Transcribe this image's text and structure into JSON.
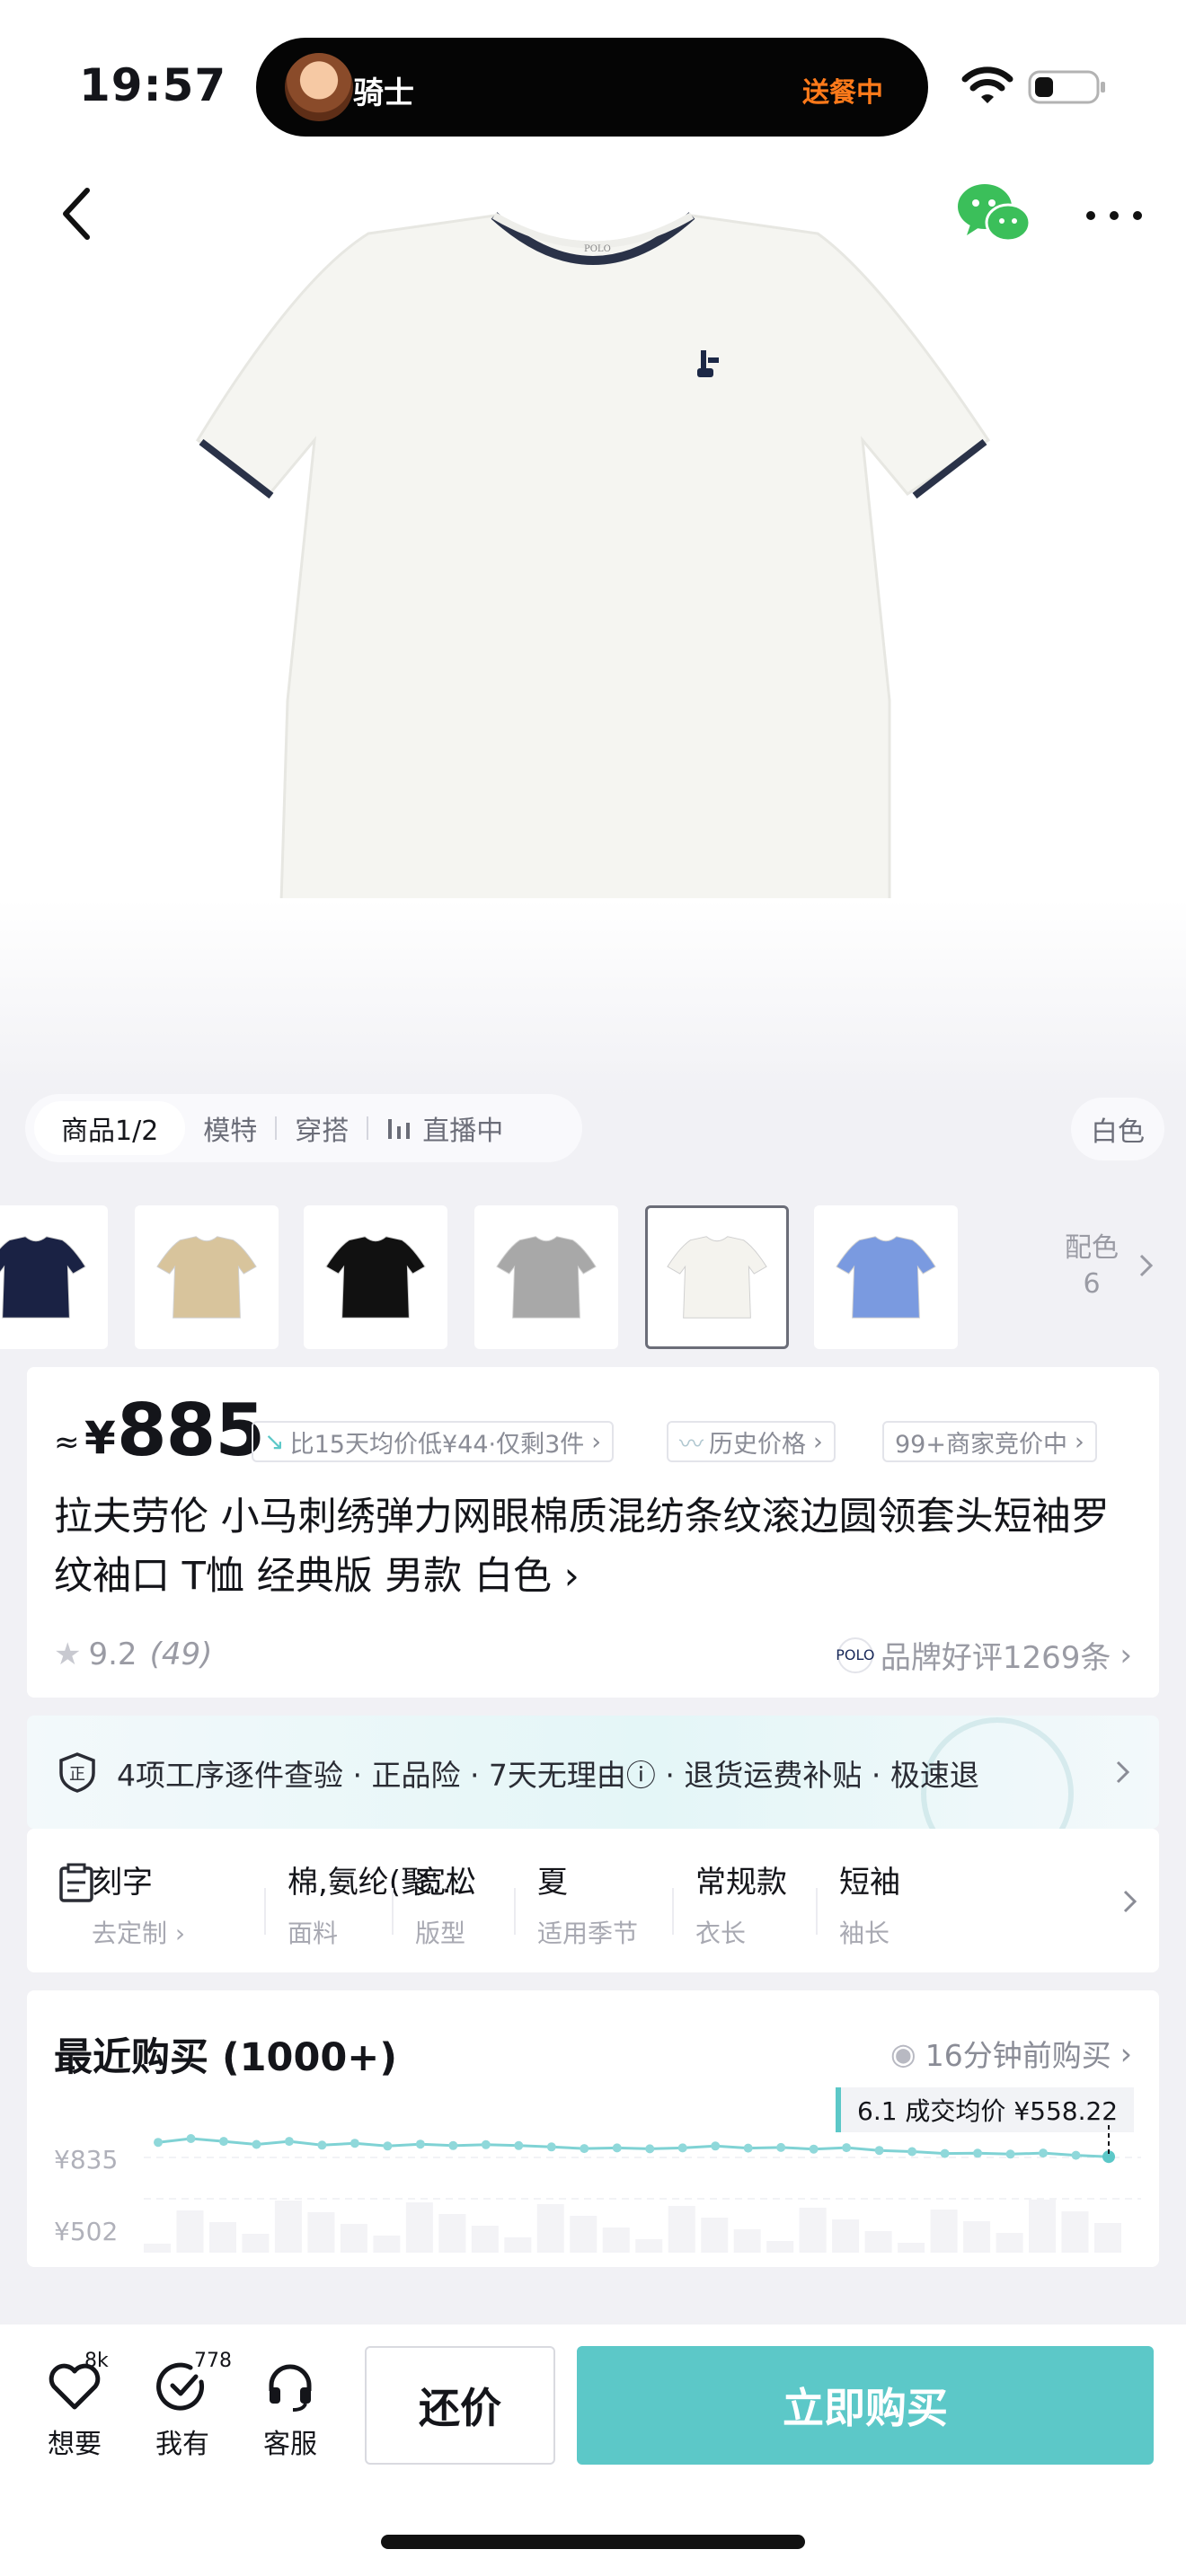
{
  "status": {
    "time": "19:57",
    "rider_name": "骑士",
    "rider_status": "送餐中"
  },
  "media": {
    "tabs": [
      "商品1/2",
      "模特",
      "穿搭",
      "直播中"
    ],
    "selected_color": "白色"
  },
  "thumbnails": {
    "colors": [
      "#1a2244",
      "#d8c49c",
      "#111111",
      "#a8a8a8",
      "#f4f3ee",
      "#7a9ae0"
    ],
    "selected_index": 4,
    "more_label": "配色",
    "more_count": "6"
  },
  "price": {
    "approx": "≈",
    "currency": "¥",
    "value": "885",
    "tag_low": "比15天均价低¥44·仅剩3件",
    "tag_history": "历史价格",
    "tag_bidding": "99+商家竞价中"
  },
  "product": {
    "title": "拉夫劳伦 小马刺绣弹力网眼棉质混纺条纹滚边圆领套头短袖罗纹袖口 T恤 经典版 男款 白色",
    "rating": "9.2",
    "rating_count": "(49)",
    "brand_logo_text": "POLO",
    "brand_review": "品牌好评1269条"
  },
  "guarantee": {
    "text": "4项工序逐件查验 · 正品险 · 7天无理由ⓘ · 退货运费补贴 · 极速退"
  },
  "attributes": [
    {
      "value": "刻字",
      "key": "去定制 ›"
    },
    {
      "value": "棉,氨纶(聚…",
      "key": "面料"
    },
    {
      "value": "宽松",
      "key": "版型"
    },
    {
      "value": "夏",
      "key": "适用季节"
    },
    {
      "value": "常规款",
      "key": "衣长"
    },
    {
      "value": "短袖",
      "key": "袖长"
    }
  ],
  "recent_purchase": {
    "title": "最近购买 (1000+)",
    "recent_text": "16分钟前购买",
    "avg_label": "6.1 成交均价 ¥558.22",
    "y_high": "¥835",
    "y_low": "¥502"
  },
  "chart_data": {
    "type": "line",
    "ylim": [
      502,
      835
    ],
    "yticks": [
      "¥835",
      "¥502"
    ],
    "values": [
      784,
      800,
      788,
      775,
      788,
      772,
      780,
      768,
      776,
      770,
      774,
      770,
      764,
      757,
      760,
      756,
      760,
      768,
      759,
      762,
      755,
      761,
      749,
      744,
      736,
      737,
      733,
      738,
      728,
      722
    ],
    "highlight": {
      "label": "6.1 成交均价 ¥558.22",
      "value": 558.22
    }
  },
  "bottom": {
    "want_label": "想要",
    "want_count": "8k",
    "have_label": "我有",
    "have_count": "778",
    "service_label": "客服",
    "counter_label": "还价",
    "buy_label": "立即购买"
  }
}
